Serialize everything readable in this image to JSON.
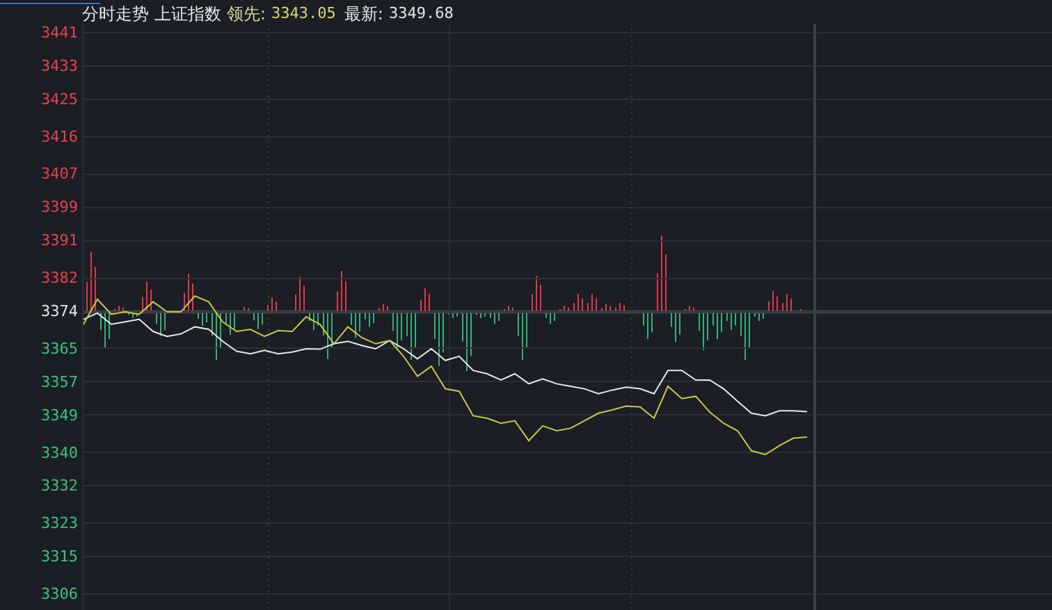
{
  "header": {
    "title": "分时走势",
    "index_name": "上证指数",
    "leading_label": "领先:",
    "leading_value": "3343.05",
    "latest_label": "最新:",
    "latest_value": "3349.68"
  },
  "chart": {
    "chart_data": {
      "type": "line",
      "categories": [
        null,
        null,
        null,
        null,
        null,
        null,
        null,
        null,
        null,
        null,
        null,
        null,
        null,
        null,
        null,
        null,
        null,
        null,
        null,
        null,
        null,
        null,
        null,
        null,
        null,
        null,
        null,
        null,
        null,
        null,
        null,
        null,
        null,
        null,
        null,
        null,
        null,
        null,
        null,
        null,
        null,
        null,
        null,
        null,
        null,
        null,
        null,
        null,
        null,
        null,
        null,
        null,
        null
      ],
      "ylim": [
        3305,
        3442
      ],
      "yticks": [
        3441,
        3433,
        3425,
        3416,
        3407,
        3399,
        3391,
        3382,
        3374,
        3365,
        3357,
        3349,
        3340,
        3332,
        3323,
        3315,
        3306
      ],
      "grid": true,
      "series": [
        {
          "color": "#e8e8e8",
          "values": [
            3371.9,
            3373.4,
            3370.7,
            3371.3,
            3371.9,
            3369.0,
            3367.8,
            3368.4,
            3370.1,
            3369.5,
            3366.6,
            3364.2,
            3363.6,
            3364.4,
            3363.6,
            3364.0,
            3364.8,
            3364.7,
            3366.0,
            3366.6,
            3365.6,
            3364.8,
            3366.8,
            3364.8,
            3362.4,
            3364.8,
            3362.0,
            3363.0,
            3359.6,
            3358.8,
            3357.3,
            3358.8,
            3356.4,
            3357.6,
            3356.4,
            3355.8,
            3355.2,
            3354.0,
            3354.9,
            3355.6,
            3355.2,
            3354.0,
            3359.6,
            3359.6,
            3357.3,
            3357.3,
            3355.2,
            3352.2,
            3349.3,
            3348.7,
            3349.9,
            3349.9,
            3349.7
          ]
        },
        {
          "color": "#c8c84a",
          "values": [
            3370.7,
            3376.7,
            3373.1,
            3373.7,
            3373.1,
            3376.1,
            3373.7,
            3373.7,
            3377.5,
            3376.1,
            3371.3,
            3369.0,
            3369.5,
            3367.8,
            3369.2,
            3369.0,
            3372.5,
            3370.7,
            3366.0,
            3370.1,
            3367.5,
            3366.0,
            3366.8,
            3363.0,
            3358.2,
            3360.6,
            3355.2,
            3354.6,
            3348.7,
            3348.1,
            3346.9,
            3347.5,
            3342.7,
            3346.3,
            3345.1,
            3345.7,
            3347.5,
            3349.3,
            3350.1,
            3351.0,
            3350.8,
            3348.1,
            3355.8,
            3352.8,
            3353.4,
            3349.6,
            3346.9,
            3345.1,
            3340.3,
            3339.4,
            3341.5,
            3343.3,
            3343.6
          ]
        }
      ]
    }
  }
}
